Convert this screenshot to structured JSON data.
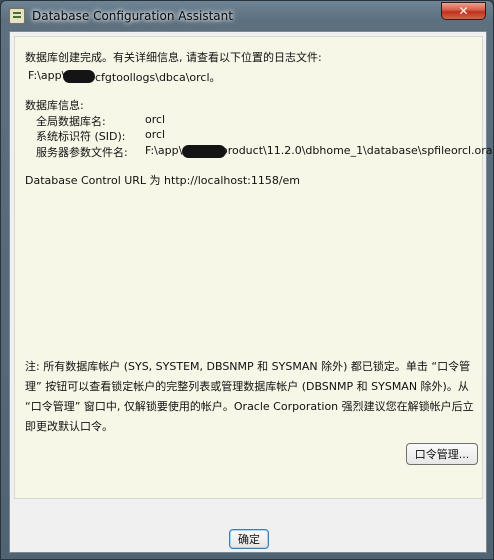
{
  "window": {
    "title": "Database Configuration Assistant"
  },
  "content": {
    "created_msg": "数据库创建完成。有关详细信息, 请查看以下位置的日志文件:",
    "log_path_prefix": "F:\\app\\",
    "log_path_suffix": "cfgtoollogs\\dbca\\orcl。",
    "db_info_header": "数据库信息:",
    "info": [
      {
        "label": "全局数据库名:",
        "value": "orcl"
      },
      {
        "label": "系统标识符 (SID):",
        "value": "orcl"
      },
      {
        "label": "服务器参数文件名:",
        "value_prefix": "F:\\app\\",
        "value_suffix": "\\product\\11.2.0\\dbhome_1\\database\\spfileorcl.ora"
      }
    ],
    "dbcontrol": "Database Control URL 为 http://localhost:1158/em",
    "note": "注: 所有数据库帐户 (SYS, SYSTEM, DBSNMP 和 SYSMAN 除外) 都已锁定。单击 “口令管理” 按钮可以查看锁定帐户的完整列表或管理数据库帐户 (DBSNMP 和 SYSMAN 除外)。从 “口令管理” 窗口中, 仅解锁要使用的帐户。Oracle Corporation 强烈建议您在解锁帐户后立即更改默认口令。"
  },
  "buttons": {
    "password_mgmt": "口令管理...",
    "ok": "确定"
  }
}
